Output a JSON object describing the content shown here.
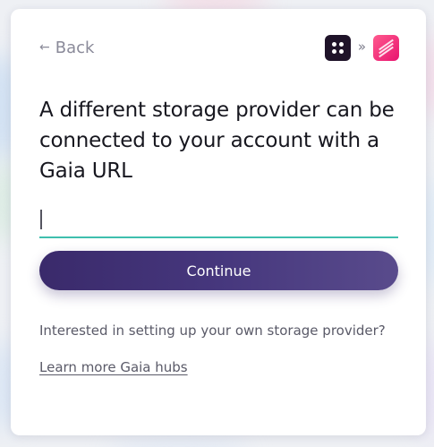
{
  "header": {
    "back_arrow": "←",
    "back_label": "Back",
    "separator": "»"
  },
  "main": {
    "title": "A different storage provider can be connected to your account with a Gaia URL",
    "url_input": {
      "value": "",
      "placeholder": ""
    },
    "continue_label": "Continue",
    "help_text": "Interested in setting up your own storage provider?",
    "learn_more_label": "Learn more Gaia hubs"
  },
  "colors": {
    "accent_primary": "#3a2a6b",
    "input_underline": "#3fbfae",
    "blockstack_icon": "#1f1329",
    "app_icon": "#e8146f"
  }
}
